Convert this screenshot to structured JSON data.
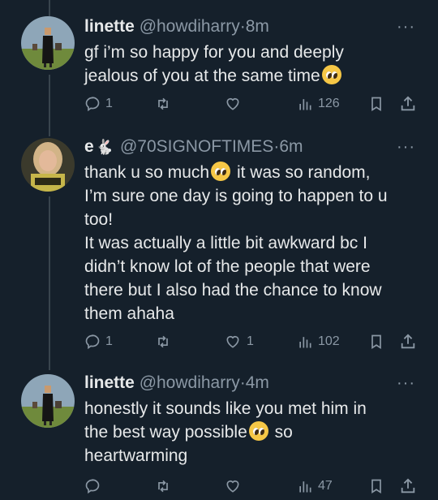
{
  "tweets": [
    {
      "name": "linette",
      "name_emoji": "",
      "handle": "@howdiharry",
      "time": "8m",
      "lines": [
        "gf i’m so happy for you and deeply",
        "jealous of you at the same time"
      ],
      "line_emoji": [
        false,
        true
      ],
      "replies": "1",
      "retweets": "",
      "likes": "",
      "views": "126"
    },
    {
      "name": "e",
      "name_emoji": "🐇",
      "handle": "@70SIGNOFTIMES",
      "time": "6m",
      "lines": [
        "thank u so much",
        "it was so random,",
        "I’m sure one day is going to happen to u",
        "too!",
        "It was actually a little bit awkward bc I",
        "didn’t know lot of the people that were",
        "there but I also had the chance to know",
        "them ahaha"
      ],
      "replies": "1",
      "retweets": "",
      "likes": "1",
      "views": "102"
    },
    {
      "name": "linette",
      "name_emoji": "",
      "handle": "@howdiharry",
      "time": "4m",
      "lines": [
        "honestly it sounds like you met him in",
        "the best way possible",
        "so",
        "heartwarming"
      ],
      "replies": "",
      "retweets": "",
      "likes": "",
      "views": "47"
    }
  ],
  "separator": "·",
  "more_glyph": "···",
  "colors": {
    "background": "#15202b",
    "text": "#e7e9ea",
    "muted": "#8b98a5",
    "thread": "#38444d"
  }
}
